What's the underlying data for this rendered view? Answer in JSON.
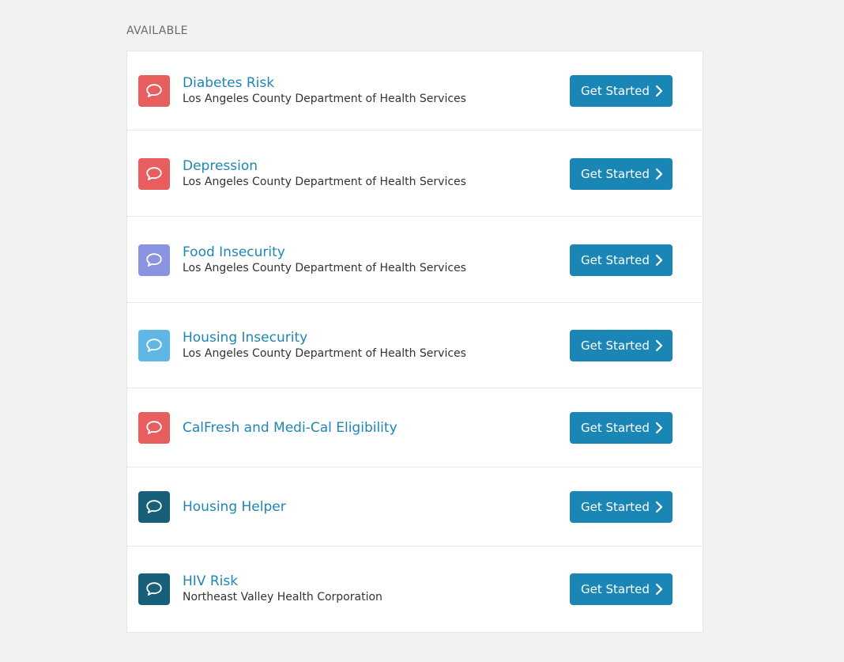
{
  "section_label": "AVAILABLE",
  "button_label": "Get Started",
  "items": [
    {
      "title": "Diabetes Risk",
      "org": "Los Angeles County Department of Health Services",
      "icon": "chat-bubble-icon",
      "color": "#e85d5d"
    },
    {
      "title": "Depression",
      "org": "Los Angeles County Department of Health Services",
      "icon": "chat-bubble-icon",
      "color": "#e85d5d"
    },
    {
      "title": "Food Insecurity",
      "org": "Los Angeles County Department of Health Services",
      "icon": "chat-bubble-icon",
      "color": "#8a93e0"
    },
    {
      "title": "Housing Insecurity",
      "org": "Los Angeles County Department of Health Services",
      "icon": "chat-bubble-icon",
      "color": "#5fb7e5"
    },
    {
      "title": "CalFresh and Medi-Cal Eligibility",
      "org": "",
      "icon": "chat-bubble-icon",
      "color": "#e85d5d"
    },
    {
      "title": "Housing Helper",
      "org": "",
      "icon": "chat-bubble-icon",
      "color": "#17607a"
    },
    {
      "title": "HIV Risk",
      "org": "Northeast Valley Health Corporation",
      "icon": "chat-bubble-icon",
      "color": "#17607a"
    }
  ]
}
